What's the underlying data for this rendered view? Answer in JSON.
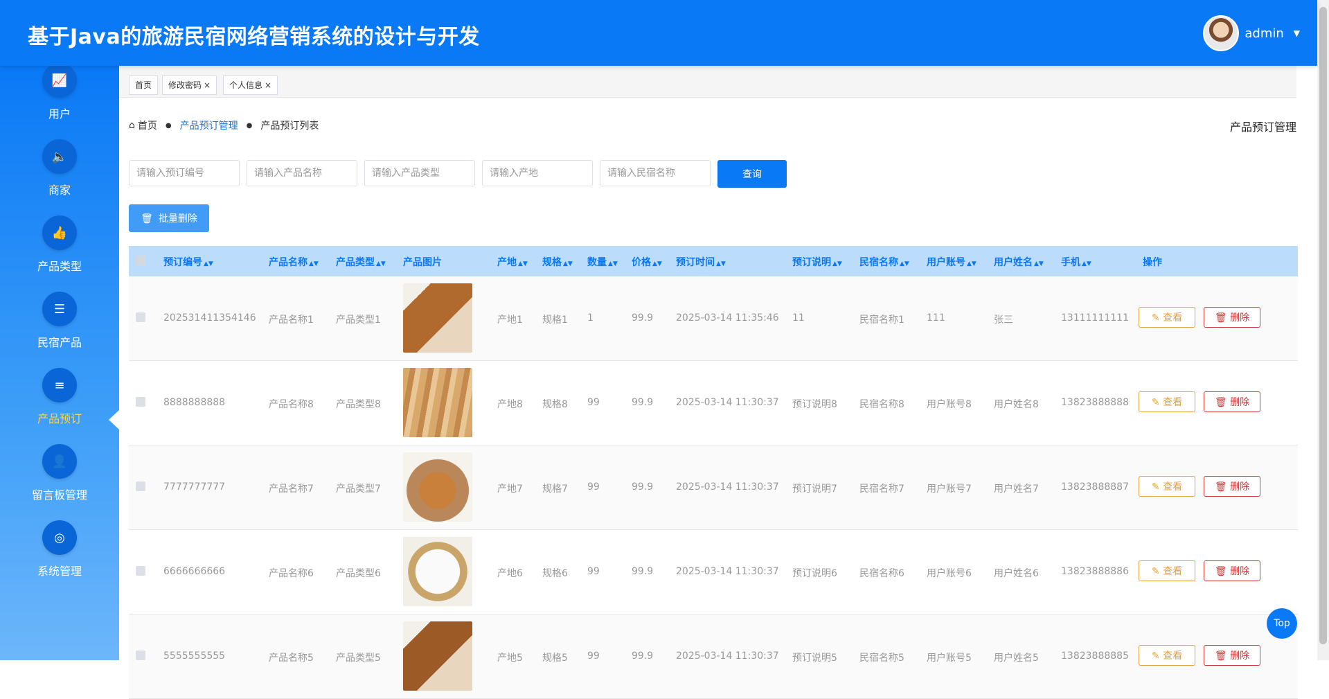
{
  "header": {
    "title": "基于Java的旅游民宿网络营销系统的设计与开发",
    "username": "admin"
  },
  "sidebar": {
    "items": [
      {
        "label": "用户",
        "icon": "chart-icon",
        "glyph": "📈"
      },
      {
        "label": "商家",
        "icon": "speaker-icon",
        "glyph": "🔈"
      },
      {
        "label": "产品类型",
        "icon": "thumbs-up-icon",
        "glyph": "👍"
      },
      {
        "label": "民宿产品",
        "icon": "list-icon",
        "glyph": "☰"
      },
      {
        "label": "产品预订",
        "icon": "menu-icon",
        "glyph": "≡",
        "active": true
      },
      {
        "label": "留言板管理",
        "icon": "person-icon",
        "glyph": "👤"
      },
      {
        "label": "系统管理",
        "icon": "user-circle-icon",
        "glyph": "◎"
      }
    ]
  },
  "tabs": [
    {
      "label": "首页",
      "closable": false
    },
    {
      "label": "修改密码",
      "closable": true
    },
    {
      "label": "个人信息",
      "closable": true
    }
  ],
  "breadcrumb": {
    "home": "首页",
    "section": "产品预订管理",
    "current": "产品预订列表"
  },
  "page_heading": "产品预订管理",
  "search": {
    "placeholders": [
      "请输入预订编号",
      "请输入产品名称",
      "请输入产品类型",
      "请输入产地",
      "请输入民宿名称"
    ],
    "button": "查询"
  },
  "batch_delete": "批量删除",
  "table": {
    "columns": [
      "预订编号",
      "产品名称",
      "产品类型",
      "产品图片",
      "产地",
      "规格",
      "数量",
      "价格",
      "预订时间",
      "预订说明",
      "民宿名称",
      "用户账号",
      "用户姓名",
      "手机",
      "操作"
    ],
    "view_label": "查看",
    "delete_label": "删除",
    "rows": [
      {
        "id": "202531411354146",
        "name": "产品名称1",
        "type": "产品类型1",
        "origin": "产地1",
        "spec": "规格1",
        "qty": "1",
        "price": "99.9",
        "time": "2025-03-14 11:35:46",
        "note": "11",
        "homestay": "民宿名称1",
        "account": "111",
        "username": "张三",
        "phone": "13111111111"
      },
      {
        "id": "8888888888",
        "name": "产品名称8",
        "type": "产品类型8",
        "origin": "产地8",
        "spec": "规格8",
        "qty": "99",
        "price": "99.9",
        "time": "2025-03-14 11:30:37",
        "note": "预订说明8",
        "homestay": "民宿名称8",
        "account": "用户账号8",
        "username": "用户姓名8",
        "phone": "13823888888"
      },
      {
        "id": "7777777777",
        "name": "产品名称7",
        "type": "产品类型7",
        "origin": "产地7",
        "spec": "规格7",
        "qty": "99",
        "price": "99.9",
        "time": "2025-03-14 11:30:37",
        "note": "预订说明7",
        "homestay": "民宿名称7",
        "account": "用户账号7",
        "username": "用户姓名7",
        "phone": "13823888887"
      },
      {
        "id": "6666666666",
        "name": "产品名称6",
        "type": "产品类型6",
        "origin": "产地6",
        "spec": "规格6",
        "qty": "99",
        "price": "99.9",
        "time": "2025-03-14 11:30:37",
        "note": "预订说明6",
        "homestay": "民宿名称6",
        "account": "用户账号6",
        "username": "用户姓名6",
        "phone": "13823888886"
      },
      {
        "id": "5555555555",
        "name": "产品名称5",
        "type": "产品类型5",
        "origin": "产地5",
        "spec": "规格5",
        "qty": "99",
        "price": "99.9",
        "time": "2025-03-14 11:30:37",
        "note": "预订说明5",
        "homestay": "民宿名称5",
        "account": "用户账号5",
        "username": "用户姓名5",
        "phone": "13823888885"
      }
    ]
  },
  "top_button": "Top",
  "colors": {
    "primary": "#0a79f6",
    "active": "#ffd54a",
    "view": "#e6a23c",
    "delete": "#cc3a3a",
    "header_row": "#bcdcfb"
  }
}
